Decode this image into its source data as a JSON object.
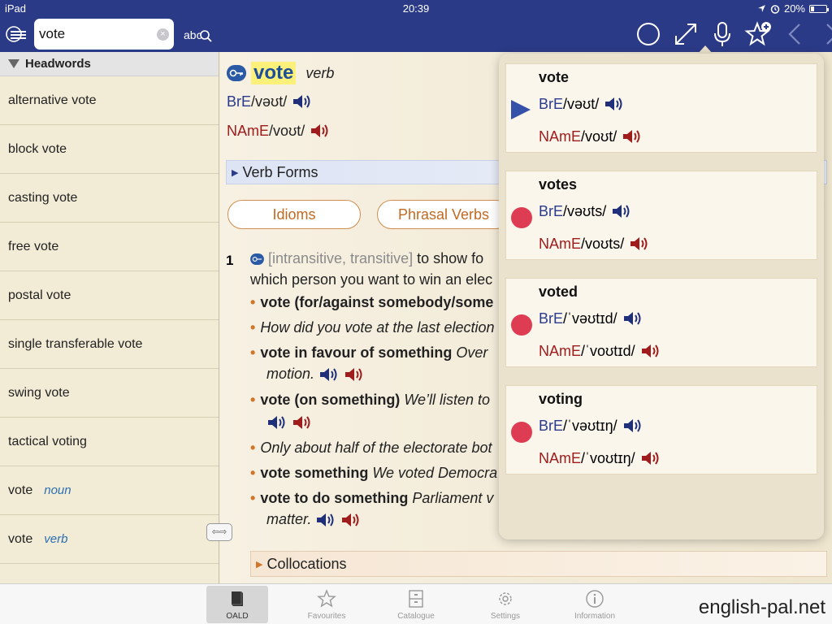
{
  "status": {
    "device": "iPad",
    "time": "20:39",
    "battery": "20%"
  },
  "search": {
    "value": "vote",
    "abc_label": "abc"
  },
  "sidebar": {
    "header": "Headwords",
    "items": [
      {
        "label": "alternative vote",
        "pos": ""
      },
      {
        "label": "block vote",
        "pos": ""
      },
      {
        "label": "casting vote",
        "pos": ""
      },
      {
        "label": "free vote",
        "pos": ""
      },
      {
        "label": "postal vote",
        "pos": ""
      },
      {
        "label": "single transferable vote",
        "pos": ""
      },
      {
        "label": "swing vote",
        "pos": ""
      },
      {
        "label": "tactical voting",
        "pos": ""
      },
      {
        "label": "vote",
        "pos": "noun"
      },
      {
        "label": "vote",
        "pos": "verb"
      }
    ]
  },
  "entry": {
    "headword": "vote",
    "pos": "verb",
    "bre_label": "BrE",
    "bre_ipa": "/vəʊt/",
    "name_label": "NAmE",
    "name_ipa": "/voʊt/",
    "verb_forms": "Verb Forms",
    "pills": {
      "idioms": "Idioms",
      "phrasal": "Phrasal Verbs"
    },
    "sense1": {
      "num": "1",
      "grammar": "[intransitive, transitive]",
      "def_a": "to show fo",
      "def_b": "which person you want to win an elec"
    },
    "examples": {
      "ex1_bold": "vote (for/against somebody/some",
      "ex2_italic": "How did you vote at the last election",
      "ex3_bold": "vote in favour of something",
      "ex3_italic": "Over",
      "ex3_cont": "motion.",
      "ex4_bold": "vote (on something)",
      "ex4_italic": "We’ll listen to",
      "ex5_italic": "Only about half of the electorate bot",
      "ex6_bold": "vote something",
      "ex6_italic": "We voted Democra",
      "ex7_bold": "vote to do something",
      "ex7_italic": "Parliament v",
      "ex7_cont": "matter."
    },
    "collocations": "Collocations"
  },
  "popover": {
    "forms": [
      {
        "word": "vote",
        "bre_label": "BrE",
        "bre_ipa": "/vəʊt/",
        "name_label": "NAmE",
        "name_ipa": "/voʊt/",
        "marker": "play"
      },
      {
        "word": "votes",
        "bre_label": "BrE",
        "bre_ipa": "/vəʊts/",
        "name_label": "NAmE",
        "name_ipa": "/voʊts/",
        "marker": "dot"
      },
      {
        "word": "voted",
        "bre_label": "BrE",
        "bre_ipa": "/ˈvəʊtɪd/",
        "name_label": "NAmE",
        "name_ipa": "/ˈvoʊtɪd/",
        "marker": "dot"
      },
      {
        "word": "voting",
        "bre_label": "BrE",
        "bre_ipa": "/ˈvəʊtɪŋ/",
        "name_label": "NAmE",
        "name_ipa": "/ˈvoʊtɪŋ/",
        "marker": "dot"
      }
    ]
  },
  "tabs": [
    {
      "label": "OALD",
      "icon": "book-icon",
      "active": true
    },
    {
      "label": "Favourites",
      "icon": "star-icon",
      "active": false
    },
    {
      "label": "Catalogue",
      "icon": "cabinet-icon",
      "active": false
    },
    {
      "label": "Settings",
      "icon": "gear-icon",
      "active": false
    },
    {
      "label": "Information",
      "icon": "info-icon",
      "active": false
    }
  ],
  "watermark": "english-pal.net",
  "colors": {
    "topbar": "#2b3a86",
    "bre": "#2a3a8c",
    "name": "#a01c1c",
    "highlight": "#fbf07a",
    "accent": "#c06a22",
    "dot": "#de3c52"
  }
}
